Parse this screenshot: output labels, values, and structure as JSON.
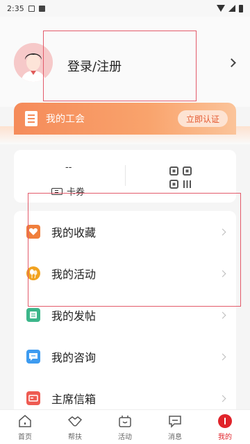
{
  "statusbar": {
    "time": "2:35"
  },
  "profile": {
    "login_label": "登录/注册"
  },
  "union": {
    "title": "我的工会",
    "verify_label": "立即认证"
  },
  "coupons": {
    "count": "--",
    "label": "卡券"
  },
  "menu": [
    {
      "label": "我的收藏",
      "icon": "favorite-icon",
      "color": "#f07f3c"
    },
    {
      "label": "我的活动",
      "icon": "balloon-icon",
      "color": "#f1a21f"
    },
    {
      "label": "我的发帖",
      "icon": "post-icon",
      "color": "#3cb68a"
    },
    {
      "label": "我的咨询",
      "icon": "chat-icon",
      "color": "#3d9bf0"
    },
    {
      "label": "主席信箱",
      "icon": "mailbox-icon",
      "color": "#ee5b52"
    }
  ],
  "tabs": [
    {
      "label": "首页",
      "icon": "home-icon"
    },
    {
      "label": "帮扶",
      "icon": "handshake-icon"
    },
    {
      "label": "活动",
      "icon": "activity-icon"
    },
    {
      "label": "消息",
      "icon": "message-icon"
    },
    {
      "label": "我的",
      "icon": "profile-icon",
      "active": true
    }
  ],
  "colors": {
    "accent": "#e0242b",
    "union_gradient_start": "#f58b5a",
    "union_gradient_end": "#fbc49a"
  }
}
